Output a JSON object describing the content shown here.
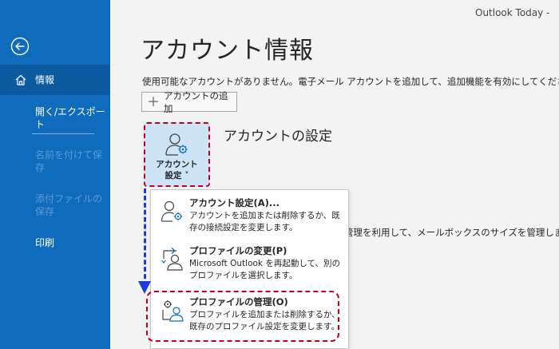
{
  "window": {
    "title": "Outlook Today  -"
  },
  "sidebar": {
    "back_icon": "arrow-left-circle-icon",
    "items": [
      {
        "label": "情報",
        "icon": "home-icon",
        "active": true
      },
      {
        "label": "開く/エクスポート"
      },
      {
        "label": "名前を付けて保存",
        "disabled": true
      },
      {
        "label": "添付ファイルの保存",
        "disabled": true
      },
      {
        "label": "印刷"
      }
    ]
  },
  "main": {
    "title": "アカウント情報",
    "description": "使用可能なアカウントがありません。電子メール アカウントを追加して、追加機能を有効にしてください。",
    "add_account_label": "アカウントの追加",
    "settings_section_heading": "アカウントの設定",
    "settings_button_label_line1": "アカウント",
    "settings_button_label_line2": "設定 ˅",
    "partial_background_text": "管理を利用して、メールボックスのサイズを管理します。"
  },
  "dropdown": {
    "items": [
      {
        "title": "アカウント設定(A)...",
        "description": "アカウントを追加または削除するか、既存の接続設定を変更します。",
        "icon": "person-gear-icon"
      },
      {
        "title": "プロファイルの変更(P)",
        "description": "Microsoft Outlook を再起動して、別のプロファイルを選択します。",
        "icon": "profile-switch-icon"
      },
      {
        "title": "プロファイルの管理(O)",
        "description": "プロファイルを追加または削除するか、既存のプロファイル設定を変更します。",
        "icon": "profile-manage-icon"
      }
    ]
  },
  "colors": {
    "sidebar_bg": "#0f6cbd",
    "sidebar_active": "#0c5aa0",
    "annotation_red": "#c0001a",
    "annotation_blue": "#1f3dd6",
    "settings_button_bg": "#cde4f7"
  }
}
